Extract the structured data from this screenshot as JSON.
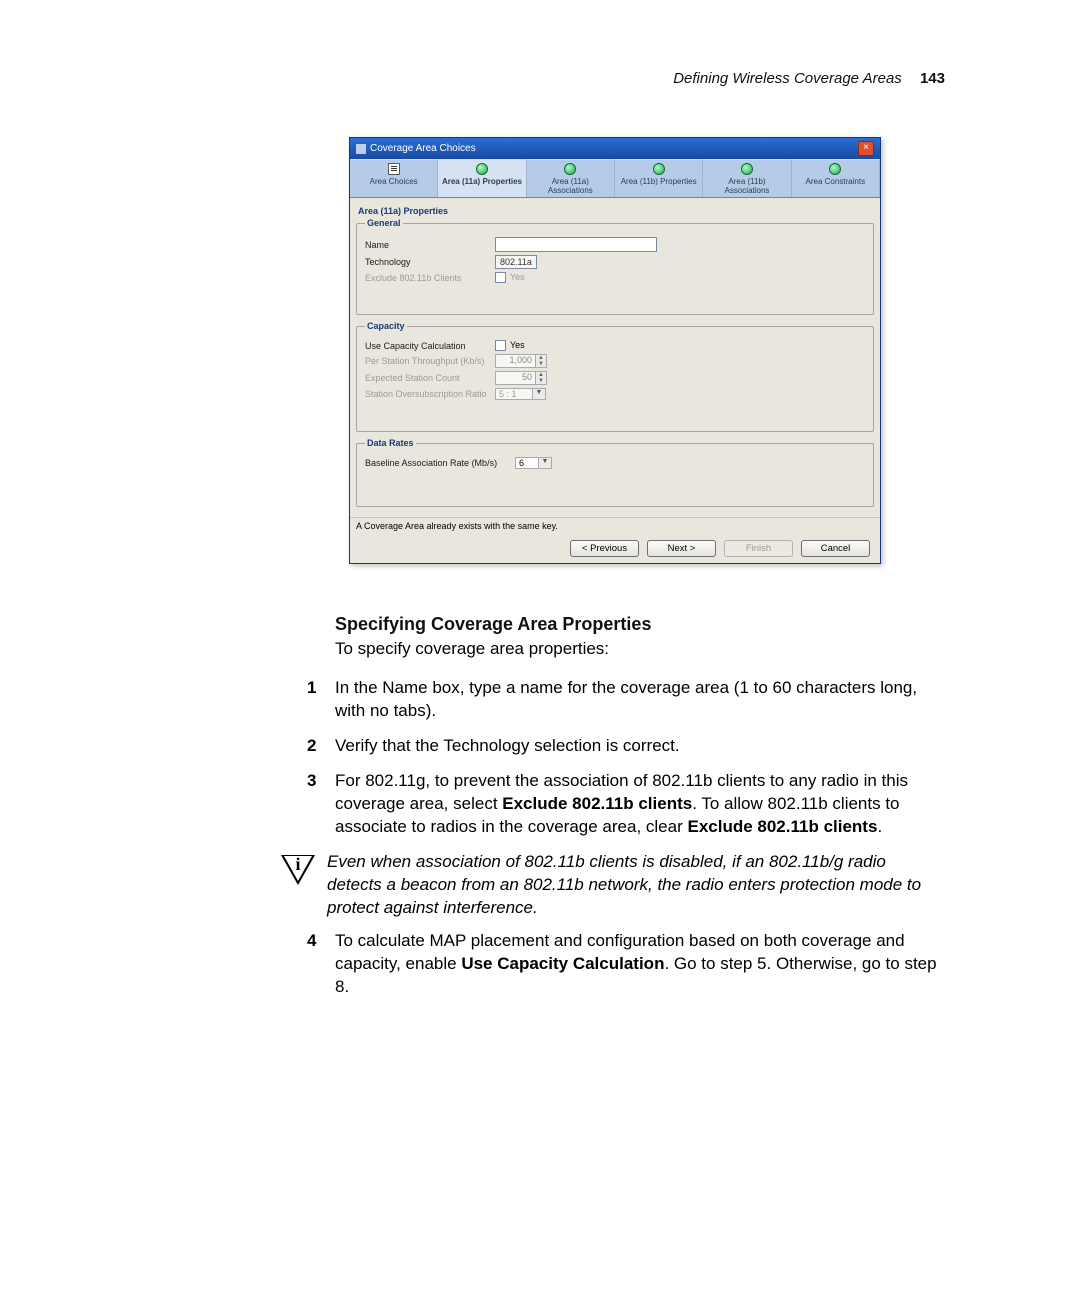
{
  "header": {
    "title": "Defining Wireless Coverage Areas",
    "page": "143"
  },
  "dialog": {
    "title": "Coverage Area Choices",
    "close": "×",
    "tabs": [
      {
        "label": "Area Choices"
      },
      {
        "label": "Area (11a) Properties"
      },
      {
        "label": "Area (11a) Associations"
      },
      {
        "label": "Area (11b) Properties"
      },
      {
        "label": "Area (11b) Associations"
      },
      {
        "label": "Area Constraints"
      }
    ],
    "panel_title": "Area (11a) Properties",
    "general": {
      "legend": "General",
      "name_label": "Name",
      "name_value": "",
      "technology_label": "Technology",
      "technology_value": "802.11a",
      "exclude_label": "Exclude 802.11b Clients",
      "exclude_value": "Yes"
    },
    "capacity": {
      "legend": "Capacity",
      "use_calc_label": "Use Capacity Calculation",
      "use_calc_value": "Yes",
      "per_station_label": "Per Station Throughput (Kb/s)",
      "per_station_value": "1,000",
      "expected_count_label": "Expected Station Count",
      "expected_count_value": "50",
      "oversub_label": "Station Oversubscription Ratio",
      "oversub_value": "5 : 1"
    },
    "data_rates": {
      "legend": "Data Rates",
      "baseline_label": "Baseline Association Rate (Mb/s)",
      "baseline_value": "6"
    },
    "status": "A Coverage Area already exists with the same key.",
    "buttons": {
      "prev": "< Previous",
      "next": "Next >",
      "finish": "Finish",
      "cancel": "Cancel"
    }
  },
  "body": {
    "section_title": "Specifying Coverage Area Properties",
    "lead": "To specify coverage area properties:",
    "steps": {
      "s1": "In the Name box, type a name for the coverage area (1 to 60 characters long, with no tabs).",
      "s2": "Verify that the Technology selection is correct.",
      "s3a": "For 802.11g, to prevent the association of 802.11b clients to any radio in this coverage area, select ",
      "s3b": "Exclude 802.11b clients",
      "s3c": ". To allow 802.11b clients to associate to radios in the coverage area, clear ",
      "s3d": "Exclude 802.11b clients",
      "s3e": ".",
      "note": "Even when association of 802.11b clients is disabled, if an 802.11b/g radio detects a beacon from an 802.11b network, the radio enters protection mode to protect against interference.",
      "s4a": "To calculate MAP placement and configuration based on both coverage and capacity, enable ",
      "s4b": "Use Capacity Calculation",
      "s4c": ". Go to step 5. Otherwise, go to step 8."
    },
    "numbers": {
      "n1": "1",
      "n2": "2",
      "n3": "3",
      "n4": "4"
    },
    "info_glyph": "i"
  }
}
